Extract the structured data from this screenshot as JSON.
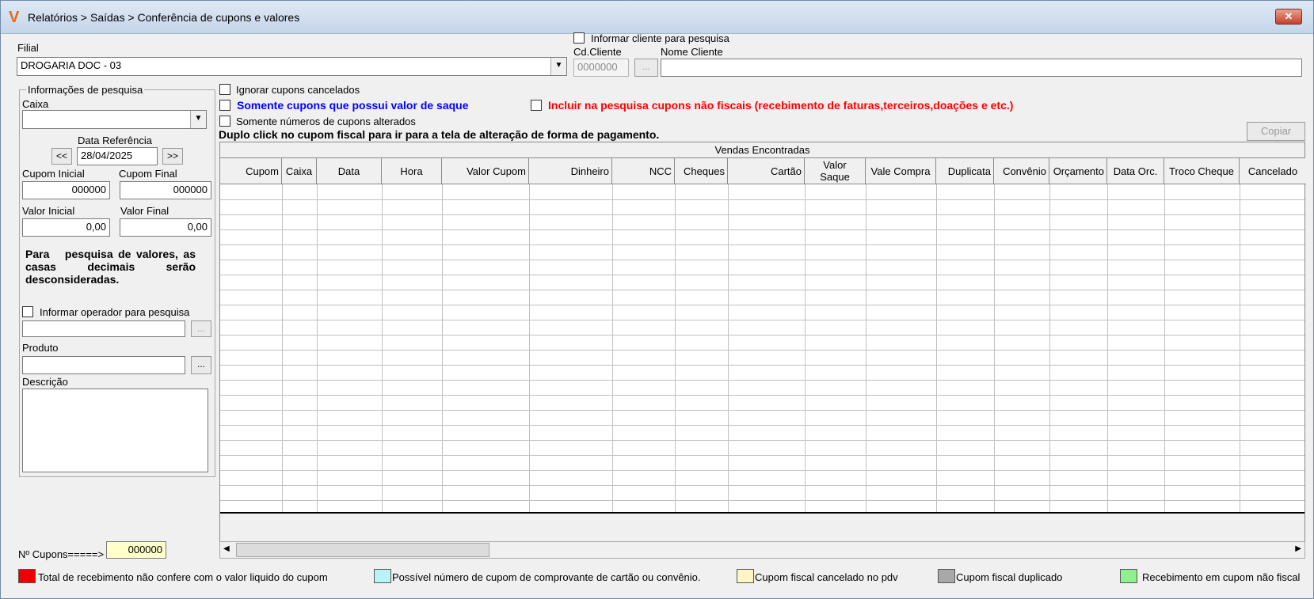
{
  "window": {
    "title": "Relatórios > Saídas > Conferência de cupons e valores",
    "logo": "V",
    "close_icon": "✕"
  },
  "filial": {
    "label": "Filial",
    "value": "DROGARIA DOC - 03"
  },
  "cliente": {
    "checkbox_label": "Informar cliente para pesquisa",
    "cd_label": "Cd.Cliente",
    "cd_value": "0000000",
    "nome_label": "Nome Cliente",
    "nome_value": "",
    "browse": "..."
  },
  "info": {
    "group_label": "Informações de pesquisa",
    "caixa_label": "Caixa",
    "caixa_value": "",
    "data_ref_label": "Data Referência",
    "prev": "<<",
    "next": ">>",
    "data_ref_value": "28/04/2025",
    "cupom_inicial_label": "Cupom Inicial",
    "cupom_inicial": "000000",
    "cupom_final_label": "Cupom Final",
    "cupom_final": "000000",
    "valor_inicial_label": "Valor Inicial",
    "valor_inicial": "0,00",
    "valor_final_label": "Valor Final",
    "valor_final": "0,00",
    "note": "Para   pesquisa de valores, as   casas decimais serão desconsideradas.",
    "operador_label": "Informar operador para pesquisa",
    "operador_value": "",
    "produto_label": "Produto",
    "produto_value": "",
    "descricao_label": "Descrição",
    "descricao_value": "",
    "browse": "..."
  },
  "options": {
    "ignorar": "Ignorar cupons cancelados",
    "saque": "Somente cupons que possui valor de saque",
    "nao_fiscais": "Incluir na pesquisa cupons não fiscais (recebimento de faturas,terceiros,doações  e etc.)",
    "alterados": "Somente números de cupons alterados",
    "hint": "Duplo click no cupom fiscal para ir para a tela de alteração de forma de pagamento.",
    "copiar": "Copiar"
  },
  "grid": {
    "title": "Vendas Encontradas",
    "columns": [
      "Cupom",
      "Caixa",
      "Data",
      "Hora",
      "Valor Cupom",
      "Dinheiro",
      "NCC",
      "Cheques",
      "Cartão",
      "Valor Saque",
      "Vale Compra",
      "Duplicata",
      "Convênio",
      "Orçamento",
      "Data Orc.",
      "Troco Cheque",
      "Cancelado"
    ]
  },
  "footer": {
    "cupons_label": "Nº Cupons=====>",
    "cupons_value": "000000"
  },
  "legend": [
    {
      "color": "#ee0000",
      "label": "Total de recebimento não confere com o valor liquido do cupom"
    },
    {
      "color": "#b7f3f7",
      "label": "Possível número de cupom de comprovante de cartão ou convênio."
    },
    {
      "color": "#fdf6c4",
      "label": "Cupom fiscal cancelado no pdv"
    },
    {
      "color": "#a8a8a8",
      "label": "Cupom fiscal duplicado"
    },
    {
      "color": "#8ef08e",
      "label": "Recebimento em cupom não fiscal"
    }
  ],
  "colors": {
    "blue_option": "#0000ff",
    "red_option": "#ff0000"
  }
}
